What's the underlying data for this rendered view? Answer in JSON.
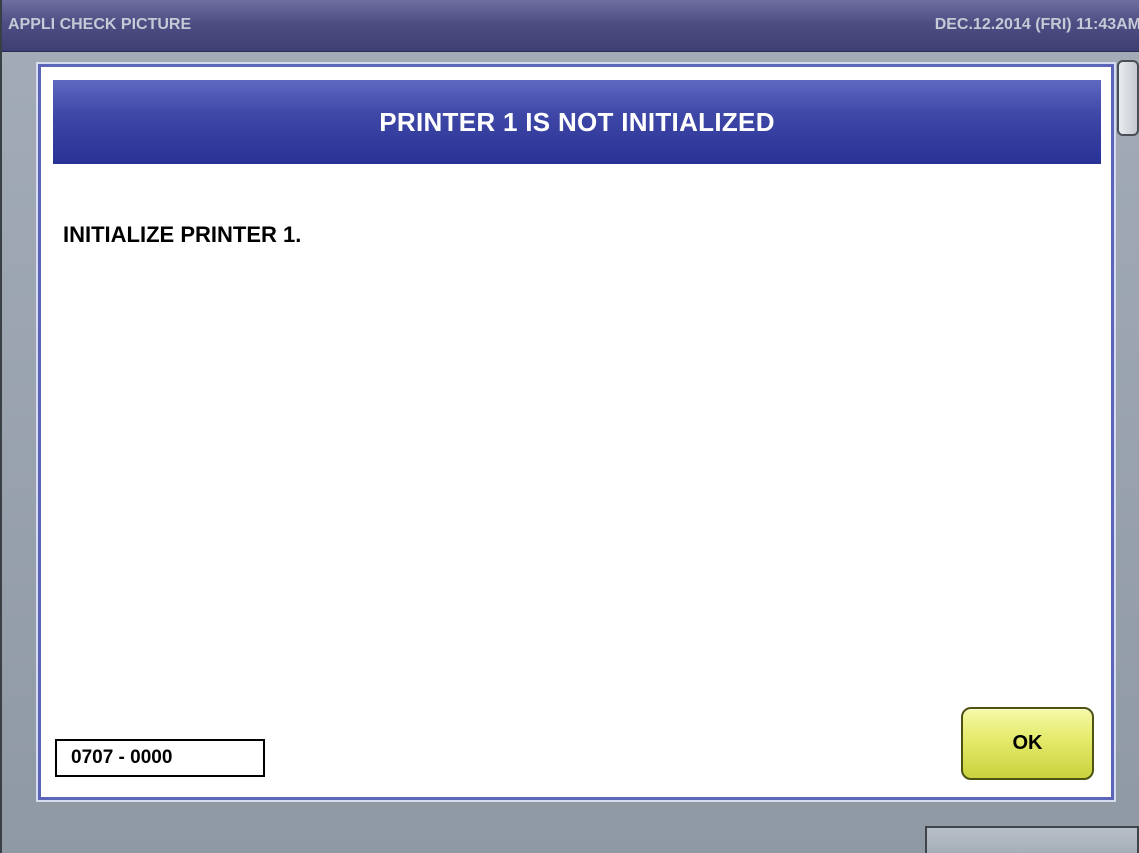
{
  "titlebar": {
    "app_title": "APPLI CHECK PICTURE",
    "datetime": "DEC.12.2014 (FRI)  11:43AM"
  },
  "dialog": {
    "title": "PRINTER 1 IS NOT INITIALIZED",
    "message": "INITIALIZE PRINTER 1.",
    "error_code": "0707 - 0000",
    "ok_label": "OK"
  },
  "colors": {
    "header_blue": "#3f48a6",
    "ok_button_yellow": "#e4ea6a",
    "titlebar_purple": "#4e4e84"
  }
}
